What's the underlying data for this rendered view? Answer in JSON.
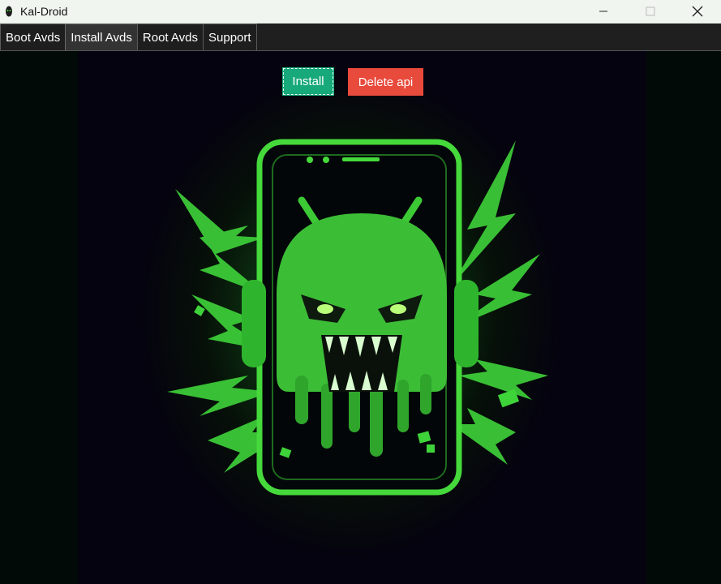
{
  "window": {
    "title": "Kal-Droid",
    "controls": [
      "minimize-icon",
      "maximize-icon",
      "close-icon"
    ]
  },
  "tabs": [
    {
      "label": "Boot Avds",
      "active": false
    },
    {
      "label": "Install Avds",
      "active": true
    },
    {
      "label": "Root Avds",
      "active": false
    },
    {
      "label": "Support",
      "active": false
    }
  ],
  "actions": {
    "install_label": "Install",
    "delete_label": "Delete api"
  },
  "colors": {
    "install_button": "#17a97a",
    "delete_button": "#e84a3c",
    "accent_green": "#3fd33a"
  },
  "artwork": {
    "icon": "evil-android-phone-icon"
  }
}
